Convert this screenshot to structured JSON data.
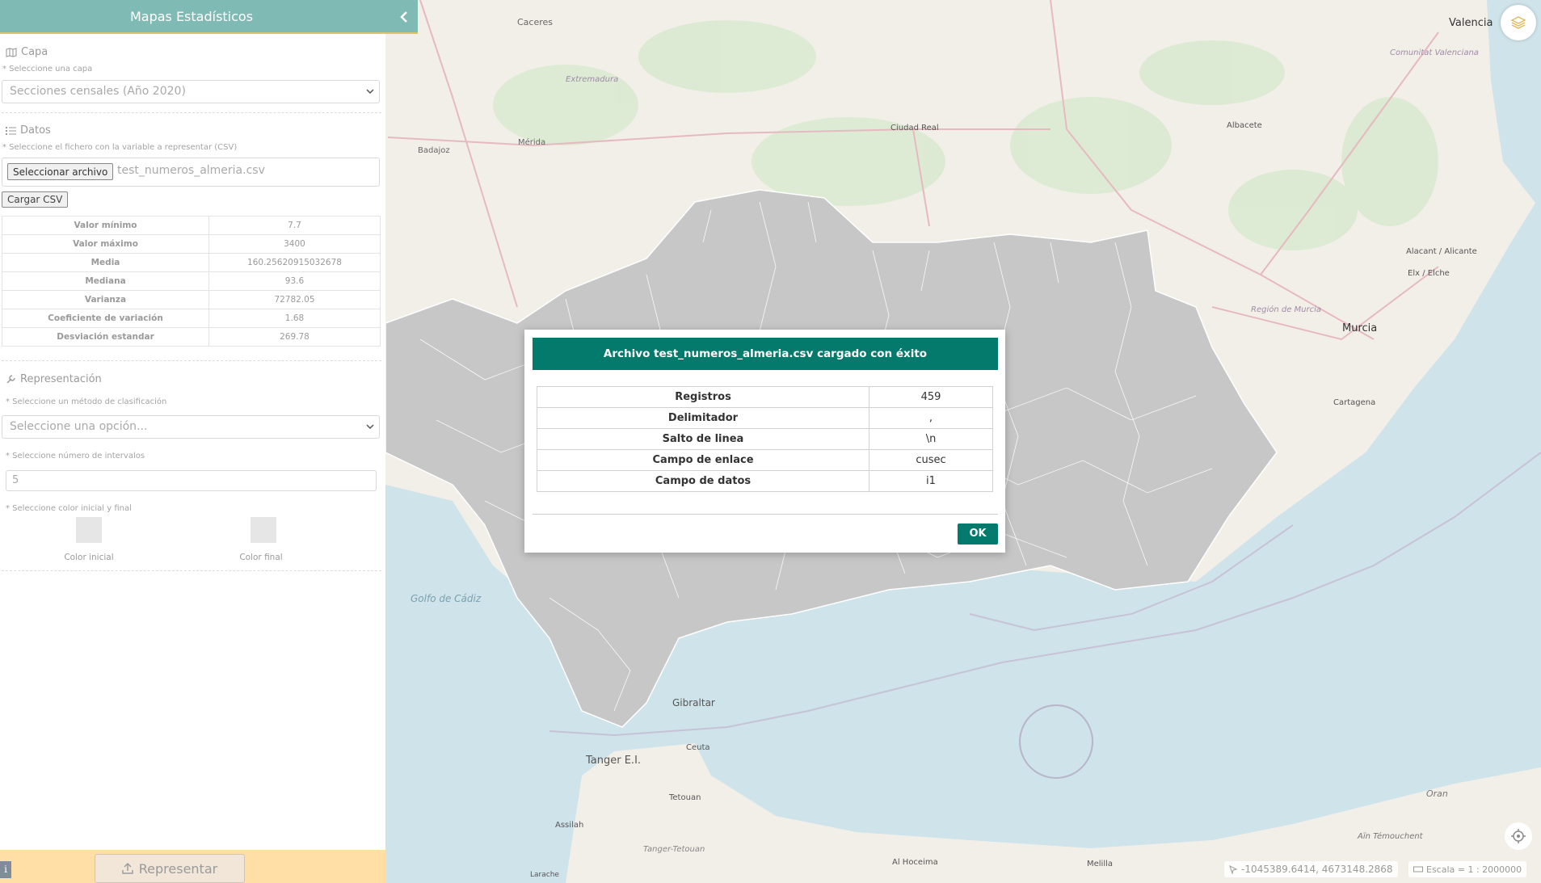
{
  "app": {
    "title": "Mapas Estadísticos"
  },
  "layer_section": {
    "title": "Capa",
    "hint": "* Seleccione una capa",
    "selected": "Secciones censales (Año 2020)"
  },
  "data_section": {
    "title": "Datos",
    "hint": "* Seleccione el fichero con la variable a representar (CSV)",
    "file_button": "Seleccionar archivo",
    "file_name": "test_numeros_almeria.csv",
    "load_button": "Cargar CSV",
    "stats": [
      {
        "label": "Valor mínimo",
        "value": "7.7"
      },
      {
        "label": "Valor máximo",
        "value": "3400"
      },
      {
        "label": "Media",
        "value": "160.25620915032678"
      },
      {
        "label": "Mediana",
        "value": "93.6"
      },
      {
        "label": "Varianza",
        "value": "72782.05"
      },
      {
        "label": "Coeficiente de variación",
        "value": "1.68"
      },
      {
        "label": "Desviación estandar",
        "value": "269.78"
      }
    ]
  },
  "representation_section": {
    "title": "Representación",
    "method_hint": "* Seleccione un método de clasificación",
    "method_placeholder": "Seleccione una opción...",
    "intervals_hint": "* Seleccione número de intervalos",
    "intervals_value": "5",
    "color_hint": "* Seleccione color inicial y final",
    "color_start_label": "Color inicial",
    "color_end_label": "Color final"
  },
  "footer": {
    "info_label": "i",
    "render_button": "Representar"
  },
  "map": {
    "place_labels": [
      "Valencia",
      "Caceres",
      "Extremadura",
      "Comunitat Valenciana",
      "Badajoz",
      "Mérida",
      "Ciudad Real",
      "Albacete",
      "Alacant / Alicante",
      "Elx / Elche",
      "Región de Murcia",
      "Murcia",
      "Cartagena",
      "Golfo de Cádiz",
      "Gibraltar",
      "Tanger E.I.",
      "Ceuta",
      "Tetouan",
      "Assilah",
      "Tanger-Tetouan",
      "Al Hoceima",
      "Melilla",
      "Oran",
      "Aïn Témouchent",
      "Larache"
    ],
    "coords": "-1045389.6414, 4673148.2868",
    "scale": "Escala = 1 : 2000000"
  },
  "modal": {
    "title": "Archivo test_numeros_almeria.csv cargado con éxito",
    "rows": [
      {
        "label": "Registros",
        "value": "459"
      },
      {
        "label": "Delimitador",
        "value": ","
      },
      {
        "label": "Salto de linea",
        "value": "\\n"
      },
      {
        "label": "Campo de enlace",
        "value": "cusec"
      },
      {
        "label": "Campo de datos",
        "value": "i1"
      }
    ],
    "ok_button": "OK"
  },
  "colors": {
    "header": "#7fbab4",
    "modal_accent": "#037a6c",
    "footer": "#ffdfa5",
    "region_fill": "#c7c7c7",
    "sea": "#cce4ec"
  }
}
